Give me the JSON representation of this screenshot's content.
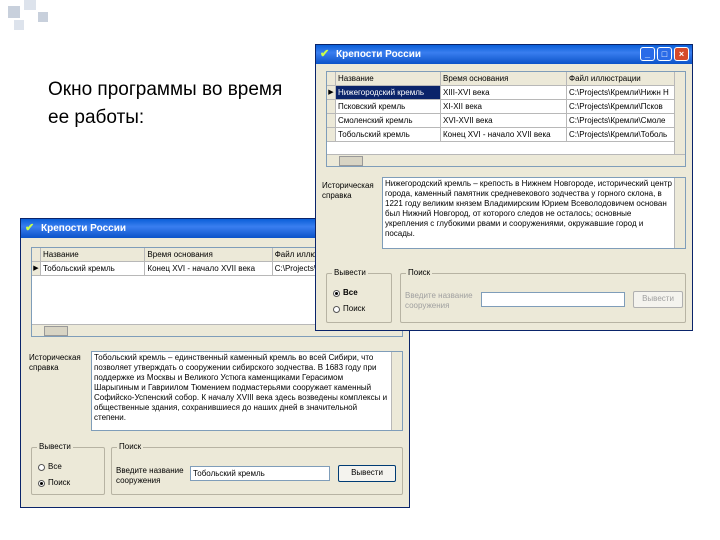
{
  "caption": "Окно программы во время ее работы:",
  "back_window": {
    "title": "Крепости России",
    "columns": [
      "Название",
      "Время основания",
      "Файл иллюстрации"
    ],
    "rows": [
      [
        "Тобольский кремль",
        "Конец XVI - начало XVII века",
        "C:\\Projects\\Кремли\\Тоболь"
      ]
    ],
    "memo_label": "Историческая справка",
    "memo_text": "Тобольский кремль – единственный каменный кремль во всей Сибири, что позволяет утверждать о сооружении сибирского зодчества. В 1683 году при поддержке из Москвы и Великого Устюга каменщиками Герасимом Шарыгиным и Гавриилом Тюмением подмастерьями сооружает каменный Софийско-Успенский собор. К началу XVIII века здесь возведены комплексы и общественные здания, сохранившиеся до наших дней в значительной степени.",
    "group_show": "Вывести",
    "radio_all": "Все",
    "radio_search": "Поиск",
    "group_search": "Поиск",
    "search_label": "Введите название сооружения",
    "search_value": "Тобольский кремль",
    "button": "Вывести"
  },
  "front_window": {
    "title": "Крепости России",
    "columns": [
      "Название",
      "Время основания",
      "Файл иллюстрации"
    ],
    "rows": [
      [
        "Нижегородский кремль",
        "XIII-XVI века",
        "C:\\Projects\\Кремли\\Нижн Н"
      ],
      [
        "Псковский кремль",
        "XI-XII века",
        "C:\\Projects\\Кремли\\Псков"
      ],
      [
        "Смоленский кремль",
        "XVI-XVII века",
        "C:\\Projects\\Кремли\\Смоле"
      ],
      [
        "Тобольский кремль",
        "Конец XVI - начало XVII века",
        "C:\\Projects\\Кремли\\Тоболь"
      ]
    ],
    "memo_label": "Историческая справка",
    "memo_text": "Нижегородский кремль – крепость в Нижнем Новгороде, исторический центр города, каменный памятник средневекового зодчества у горного склона, в 1221 году великим князем Владимирским Юрием Всеволодовичем основан был Нижний Новгород, от которого следов не осталось; основные укрепления с глубокими рвами и сооружениями, окружавшие город и посады.",
    "group_show": "Вывести",
    "radio_all": "Все",
    "radio_search": "Поиск",
    "group_search": "Поиск",
    "search_label": "Введите название сооружения",
    "search_value": "",
    "button": "Вывести",
    "window_buttons": [
      "_",
      "□",
      "×"
    ]
  }
}
